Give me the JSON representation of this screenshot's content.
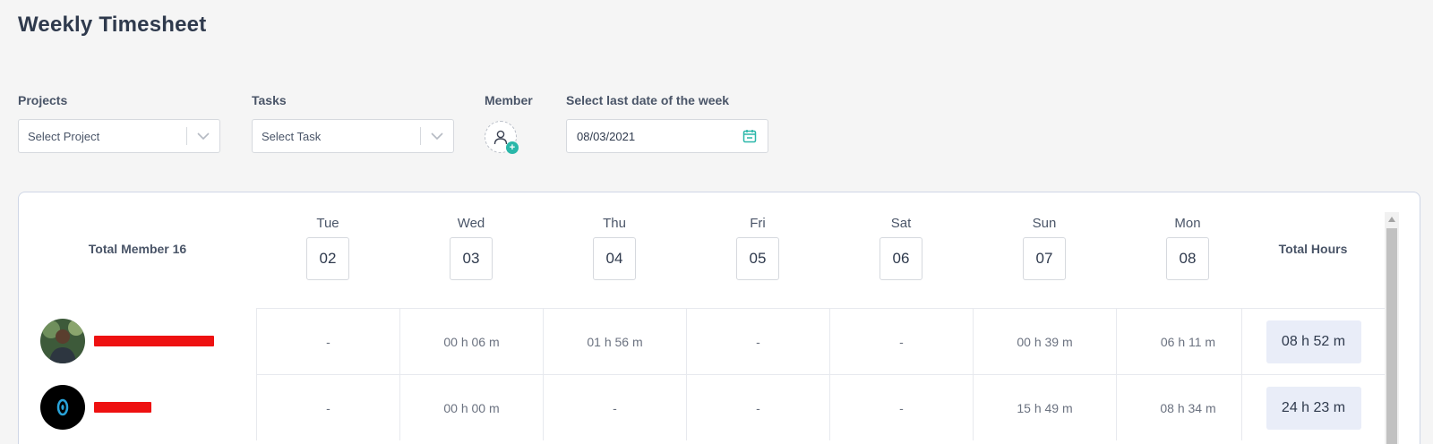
{
  "page": {
    "title": "Weekly Timesheet"
  },
  "filters": {
    "projects": {
      "label": "Projects",
      "placeholder": "Select Project"
    },
    "tasks": {
      "label": "Tasks",
      "placeholder": "Select Task"
    },
    "member": {
      "label": "Member"
    },
    "date": {
      "label": "Select last date of the week",
      "value": "08/03/2021"
    }
  },
  "colors": {
    "accent": "#2ab7a9",
    "total_bg": "#e9edf8",
    "redaction": "#ee1111"
  },
  "table": {
    "total_members_label": "Total Member 16",
    "total_hours_label": "Total Hours",
    "days": [
      {
        "name": "Tue",
        "date": "02"
      },
      {
        "name": "Wed",
        "date": "03"
      },
      {
        "name": "Thu",
        "date": "04"
      },
      {
        "name": "Fri",
        "date": "05"
      },
      {
        "name": "Sat",
        "date": "06"
      },
      {
        "name": "Sun",
        "date": "07"
      },
      {
        "name": "Mon",
        "date": "08"
      }
    ],
    "rows": [
      {
        "hours": [
          "-",
          "00 h 06 m",
          "01 h 56 m",
          "-",
          "-",
          "00 h 39 m",
          "06 h 11 m"
        ],
        "total": "08 h 52 m"
      },
      {
        "hours": [
          "-",
          "00 h 00 m",
          "-",
          "-",
          "-",
          "15 h 49 m",
          "08 h 34 m"
        ],
        "total": "24 h 23 m"
      }
    ]
  }
}
